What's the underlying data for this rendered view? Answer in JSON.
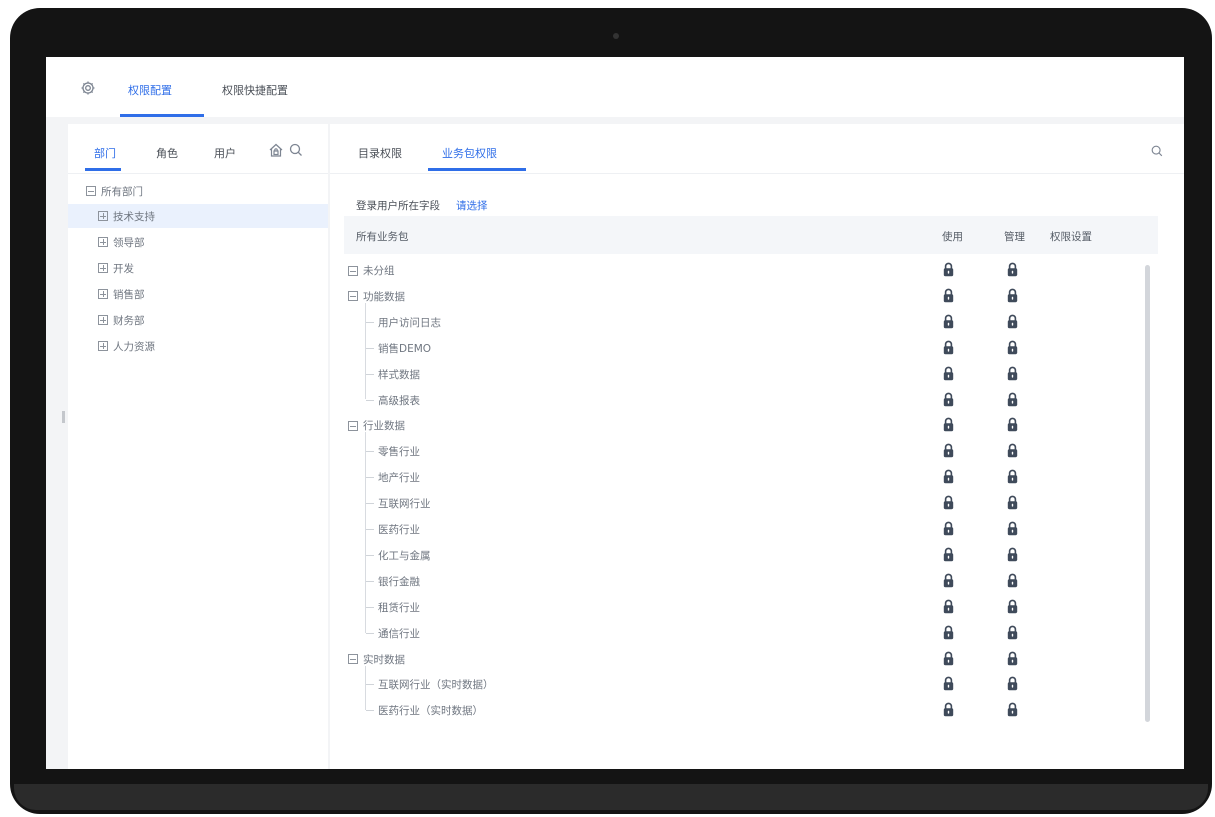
{
  "header": {
    "tabs": [
      {
        "label": "权限配置",
        "active": true
      },
      {
        "label": "权限快捷配置",
        "active": false
      }
    ],
    "settings_icon": "gear-icon"
  },
  "left_panel": {
    "tabs": [
      {
        "label": "部门",
        "active": true
      },
      {
        "label": "角色",
        "active": false
      },
      {
        "label": "用户",
        "active": false
      }
    ],
    "icons": [
      "home-lock-icon",
      "search-icon"
    ],
    "tree": [
      {
        "label": "所有部门",
        "level": 0,
        "toggle": "minus",
        "selected": false
      },
      {
        "label": "技术支持",
        "level": 1,
        "toggle": "plus",
        "selected": true
      },
      {
        "label": "领导部",
        "level": 1,
        "toggle": "plus",
        "selected": false
      },
      {
        "label": "开发",
        "level": 1,
        "toggle": "plus",
        "selected": false
      },
      {
        "label": "销售部",
        "level": 1,
        "toggle": "plus",
        "selected": false
      },
      {
        "label": "财务部",
        "level": 1,
        "toggle": "plus",
        "selected": false
      },
      {
        "label": "人力资源",
        "level": 1,
        "toggle": "plus",
        "selected": false
      }
    ]
  },
  "right_panel": {
    "tabs": [
      {
        "label": "目录权限",
        "active": false
      },
      {
        "label": "业务包权限",
        "active": true
      }
    ],
    "search_icon": "search-icon",
    "login_field_label": "登录用户所在字段",
    "login_field_link": "请选择",
    "table": {
      "columns": [
        "所有业务包",
        "使用",
        "管理",
        "权限设置"
      ],
      "rows": [
        {
          "label": "未分组",
          "group": true
        },
        {
          "label": "功能数据",
          "group": true
        },
        {
          "label": "用户访问日志",
          "group": false
        },
        {
          "label": "销售DEMO",
          "group": false
        },
        {
          "label": "样式数据",
          "group": false
        },
        {
          "label": "高级报表",
          "group": false
        },
        {
          "label": "行业数据",
          "group": true
        },
        {
          "label": "零售行业",
          "group": false
        },
        {
          "label": "地产行业",
          "group": false
        },
        {
          "label": "互联网行业",
          "group": false
        },
        {
          "label": "医药行业",
          "group": false
        },
        {
          "label": "化工与金属",
          "group": false
        },
        {
          "label": "银行金融",
          "group": false
        },
        {
          "label": "租赁行业",
          "group": false
        },
        {
          "label": "通信行业",
          "group": false
        },
        {
          "label": "实时数据",
          "group": true
        },
        {
          "label": "互联网行业（实时数据）",
          "group": false
        },
        {
          "label": "医药行业（实时数据）",
          "group": false
        }
      ]
    }
  },
  "colors": {
    "accent": "#2f6ee8",
    "lock": "#3f4a5a",
    "selected_row": "#eaf1fd"
  }
}
